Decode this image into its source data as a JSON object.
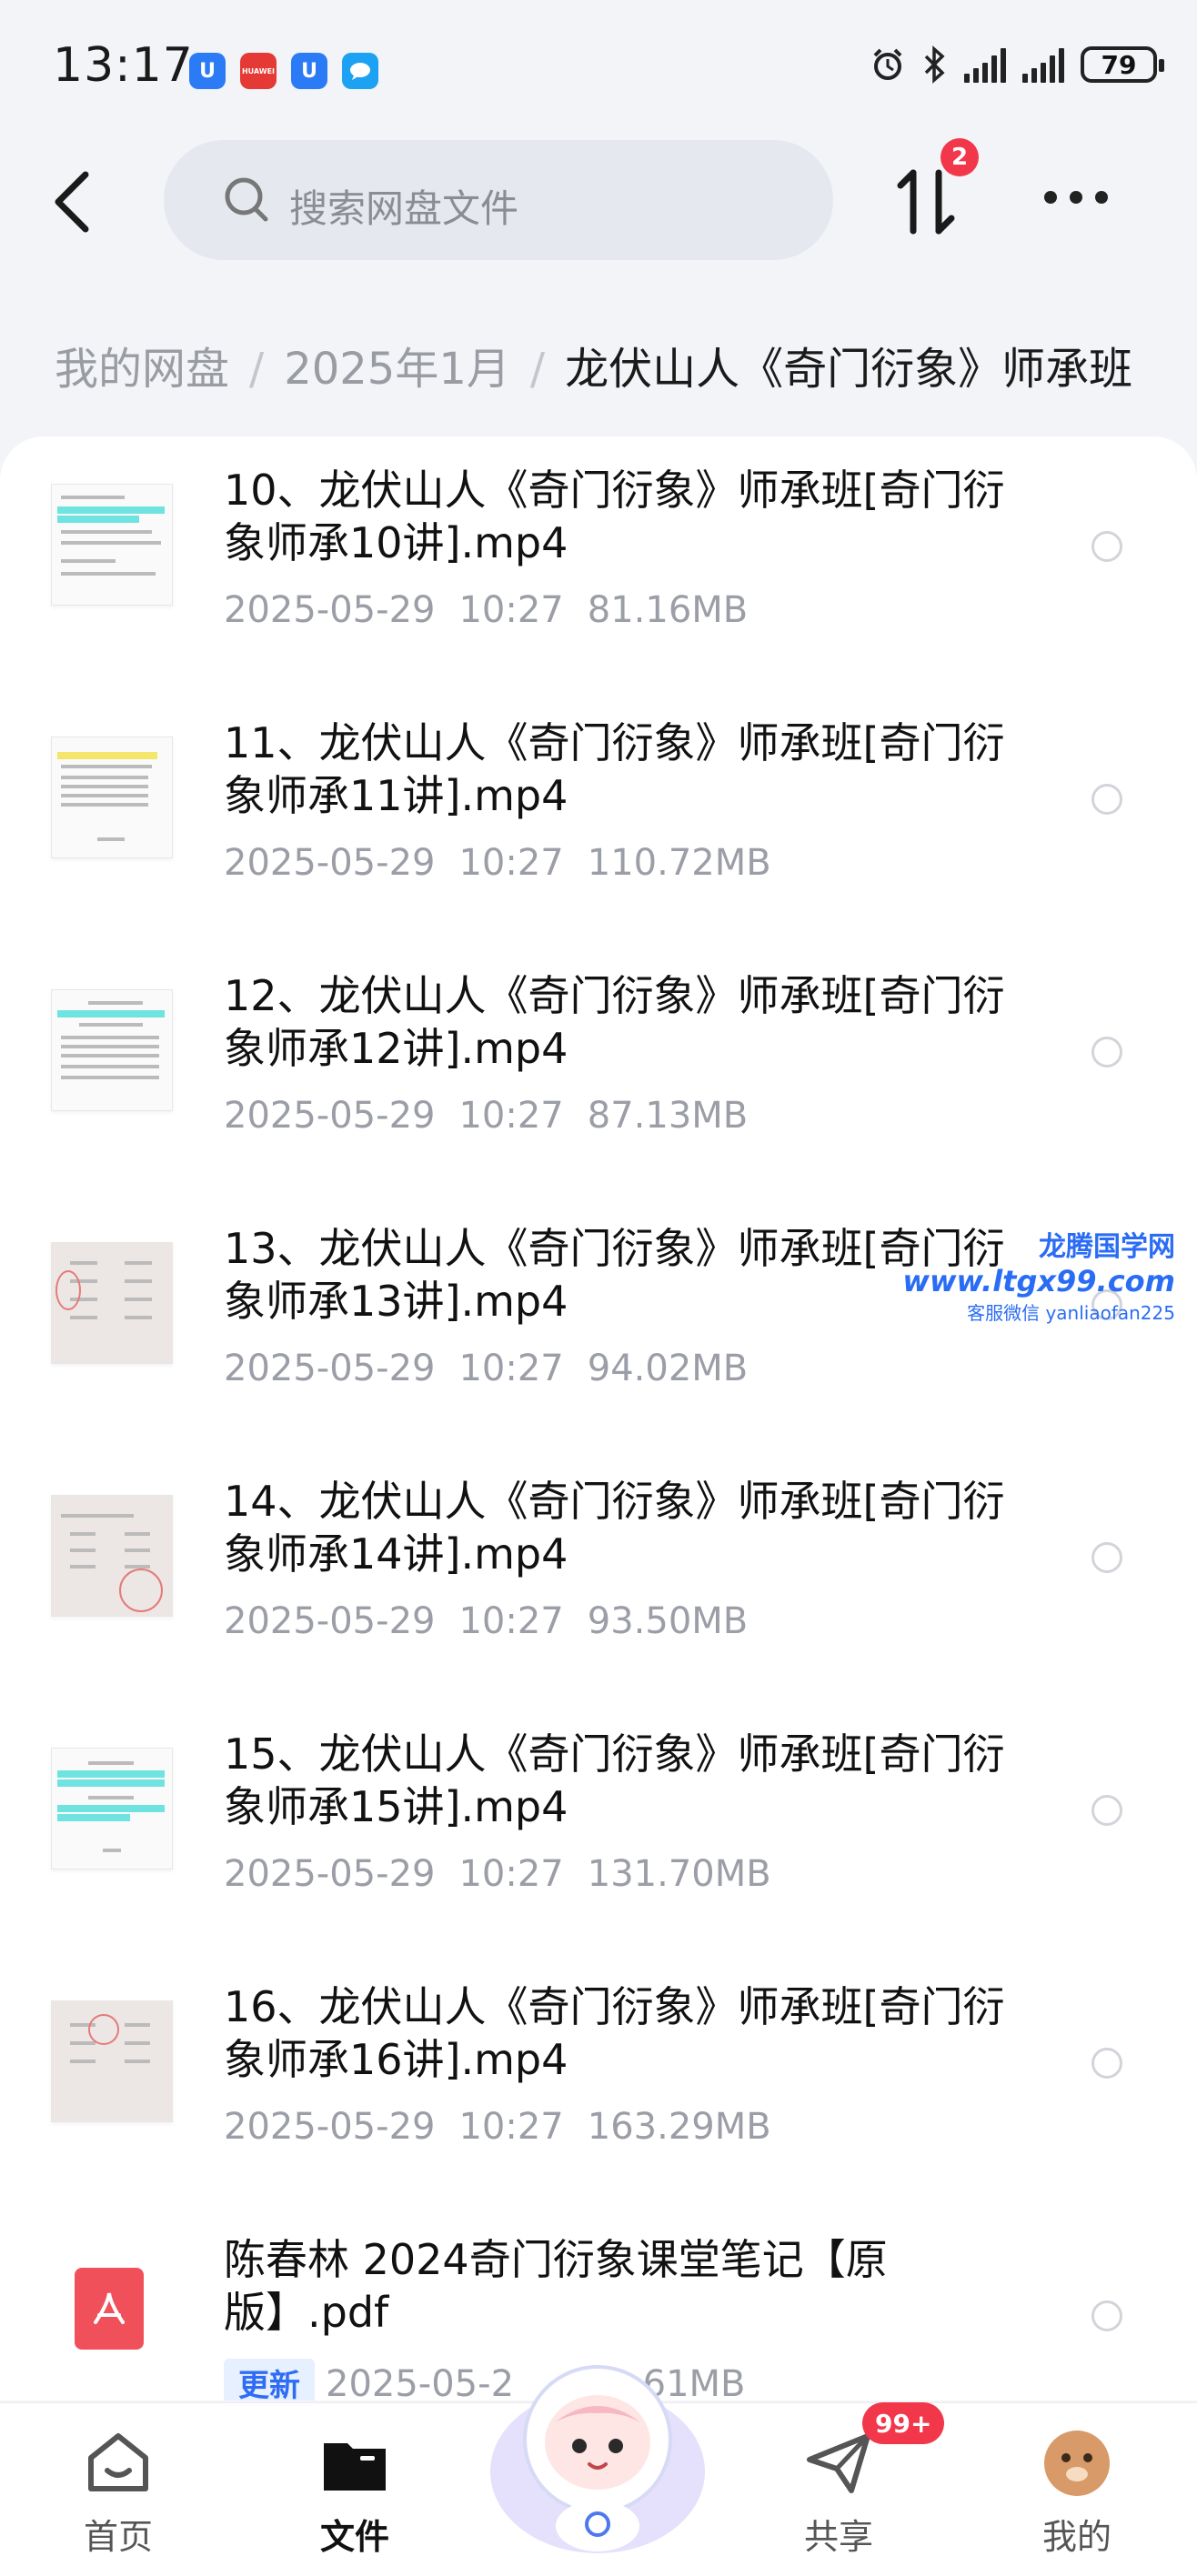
{
  "status_bar": {
    "time": "13:17",
    "battery": "79",
    "app_icons": [
      "baidu-netdisk-icon",
      "huawei-icon",
      "baidu-netdisk-icon",
      "chat-icon"
    ],
    "huawei_label": "HUAWEI"
  },
  "header": {
    "search_placeholder": "搜索网盘文件",
    "transfer_badge": "2"
  },
  "breadcrumb": {
    "items": [
      "我的网盘",
      "2025年1月",
      "龙伏山人《奇门衍象》师承班"
    ],
    "separator": "/"
  },
  "files": [
    {
      "name": "10、龙伏山人《奇门衍象》师承班[奇门衍象师承10讲].mp4",
      "date": "2025-05-29",
      "time": "10:27",
      "size": "81.16MB"
    },
    {
      "name": "11、龙伏山人《奇门衍象》师承班[奇门衍象师承11讲].mp4",
      "date": "2025-05-29",
      "time": "10:27",
      "size": "110.72MB"
    },
    {
      "name": "12、龙伏山人《奇门衍象》师承班[奇门衍象师承12讲].mp4",
      "date": "2025-05-29",
      "time": "10:27",
      "size": "87.13MB"
    },
    {
      "name": "13、龙伏山人《奇门衍象》师承班[奇门衍象师承13讲].mp4",
      "date": "2025-05-29",
      "time": "10:27",
      "size": "94.02MB"
    },
    {
      "name": "14、龙伏山人《奇门衍象》师承班[奇门衍象师承14讲].mp4",
      "date": "2025-05-29",
      "time": "10:27",
      "size": "93.50MB"
    },
    {
      "name": "15、龙伏山人《奇门衍象》师承班[奇门衍象师承15讲].mp4",
      "date": "2025-05-29",
      "time": "10:27",
      "size": "131.70MB"
    },
    {
      "name": "16、龙伏山人《奇门衍象》师承班[奇门衍象师承16讲].mp4",
      "date": "2025-05-29",
      "time": "10:27",
      "size": "163.29MB"
    },
    {
      "name": "陈春林 2024奇门衍象课堂笔记【原版】.pdf",
      "tag": "更新",
      "date": "2025-05-2",
      "size": "72.61MB"
    }
  ],
  "watermark": {
    "line1": "龙腾国学网",
    "line2": "www.ltgx99.com",
    "line3": "客服微信 yanliaofan225"
  },
  "tabbar": {
    "home": "首页",
    "files": "文件",
    "share": "共享",
    "share_badge": "99+",
    "mine": "我的"
  },
  "colors": {
    "accent_blue": "#2f6cf5",
    "badge_red": "#f2374a",
    "pdf_red": "#f0505a",
    "thumb_highlight": "#6fe3e0"
  }
}
